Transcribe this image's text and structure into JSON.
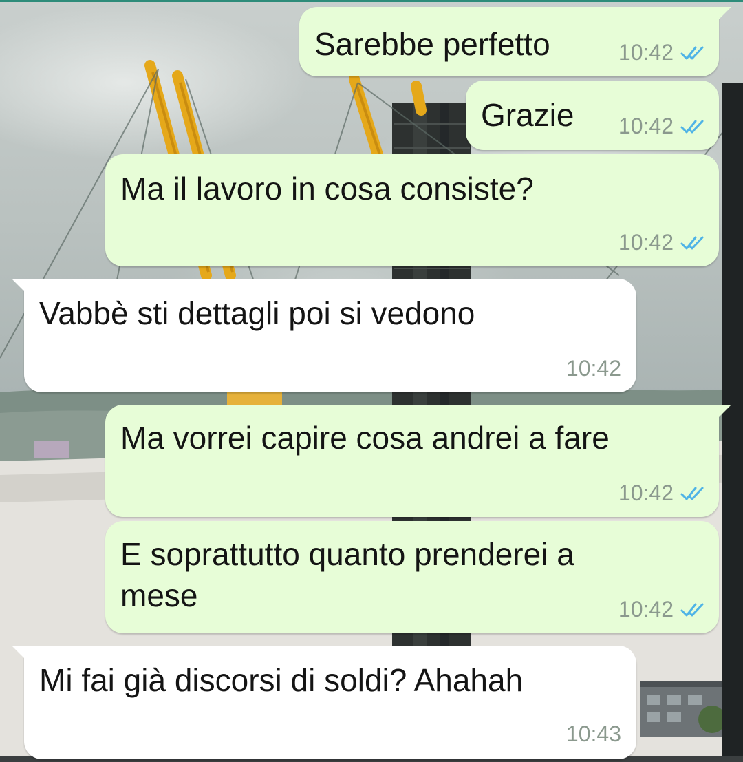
{
  "theme": {
    "outgoing_bubble": "#e7fdd7",
    "incoming_bubble": "#ffffff",
    "read_ticks": "#4fb3e6",
    "time_color": "#8b998e"
  },
  "messages": [
    {
      "direction": "outgoing",
      "text": "Sarebbe perfetto",
      "time": "10:42",
      "status": "read",
      "status_icon": "double-check-icon"
    },
    {
      "direction": "outgoing",
      "text": "Grazie",
      "time": "10:42",
      "status": "read",
      "status_icon": "double-check-icon"
    },
    {
      "direction": "outgoing",
      "text": "Ma il lavoro in cosa consiste?",
      "time": "10:42",
      "status": "read",
      "status_icon": "double-check-icon"
    },
    {
      "direction": "incoming",
      "text": "Vabbè sti dettagli poi si vedono",
      "time": "10:42"
    },
    {
      "direction": "outgoing",
      "text": "Ma vorrei capire cosa andrei a fare",
      "time": "10:42",
      "status": "read",
      "status_icon": "double-check-icon"
    },
    {
      "direction": "outgoing",
      "text": "E soprattutto quanto prenderei a mese",
      "time": "10:42",
      "status": "read",
      "status_icon": "double-check-icon"
    },
    {
      "direction": "incoming",
      "text": "Mi fai già discorsi di soldi? Ahahah",
      "time": "10:43"
    }
  ]
}
